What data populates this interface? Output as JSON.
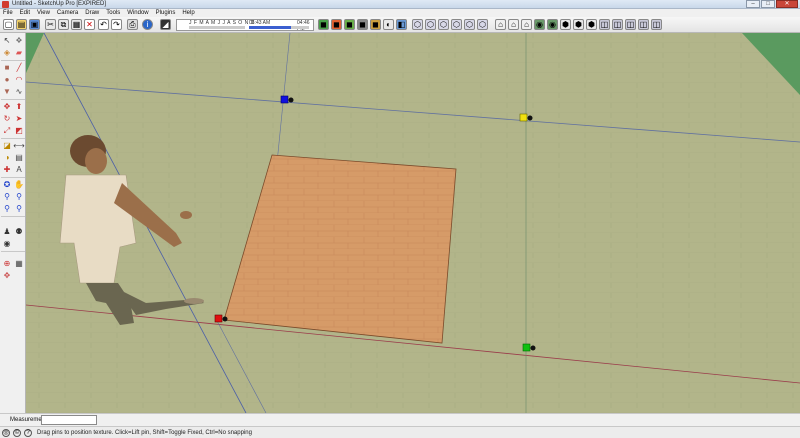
{
  "window": {
    "title": "Untitled - SketchUp Pro [EXPIRED]",
    "minimize": "–",
    "maximize": "□",
    "close": "✕"
  },
  "menu": [
    "File",
    "Edit",
    "View",
    "Camera",
    "Draw",
    "Tools",
    "Window",
    "Plugins",
    "Help"
  ],
  "shadow_settings": {
    "months": "J F M A M J J A S O N D",
    "sunrise_time": "06:43 AM",
    "noon_label": "Noon",
    "sunset_time": "04:46 PM"
  },
  "toolbar_icons": [
    "select-icon",
    "new-icon",
    "open-icon",
    "save-icon",
    "cut-icon",
    "copy-icon",
    "paste-icon",
    "erase-icon",
    "undo-icon",
    "redo-icon",
    "print-icon",
    "model-info-icon",
    "shadow-toggle-icon",
    "components-icon",
    "materials-icon",
    "styles-icon",
    "layers-icon",
    "scenes-icon",
    "shadows-icon",
    "fog-icon",
    "match-photo-icon",
    "soften-edges-icon",
    "iso-view-icon",
    "top-view-icon",
    "front-view-icon",
    "right-view-icon",
    "back-view-icon",
    "left-view-icon",
    "xray-icon",
    "wireframe-icon",
    "hidden-line-icon",
    "shaded-icon",
    "shaded-texture-icon",
    "monochrome-icon",
    "get-models-icon",
    "share-model-icon",
    "share-component-icon",
    "google-earth-icon",
    "terrain-icon",
    "place-model-icon",
    "snapshot-icon",
    "add-location-icon"
  ],
  "left_tools": [
    "select-tool-icon",
    "make-component-icon",
    "paint-bucket-icon",
    "eraser-icon",
    "rectangle-icon",
    "line-icon",
    "circle-icon",
    "arc-icon",
    "polygon-icon",
    "freehand-icon",
    "move-icon",
    "push-pull-icon",
    "rotate-icon",
    "follow-me-icon",
    "scale-icon",
    "offset-icon",
    "tape-measure-icon",
    "dimension-icon",
    "protractor-icon",
    "text-icon",
    "axes-icon",
    "3d-text-icon",
    "orbit-icon",
    "pan-icon",
    "zoom-icon",
    "zoom-window-icon",
    "previous-view-icon",
    "zoom-extents-icon",
    "position-camera-icon",
    "walk-icon",
    "look-around-icon",
    "section-plane-icon",
    "sandbox-icon",
    "add-location-tool-icon"
  ],
  "texture_pins": {
    "red": {
      "color": "#e01010",
      "label": "red-texture-pin"
    },
    "green": {
      "color": "#10c010",
      "label": "green-texture-pin"
    },
    "blue": {
      "color": "#1010e0",
      "label": "blue-texture-pin"
    },
    "yellow": {
      "color": "#f0e010",
      "label": "yellow-texture-pin"
    }
  },
  "colors": {
    "ground": "#b2b58a",
    "sky": "#5a9a5f",
    "texture_face": "#d69b68",
    "red_axis": "#b03030",
    "green_axis": "#2e7a2e",
    "blue_axis": "#3030b0"
  },
  "measurements": {
    "label": "Measurements",
    "value": ""
  },
  "status": {
    "text": "Drag pins to position texture. Click=Lift pin, Shift=Toggle Fixed, Ctrl=No snapping"
  }
}
